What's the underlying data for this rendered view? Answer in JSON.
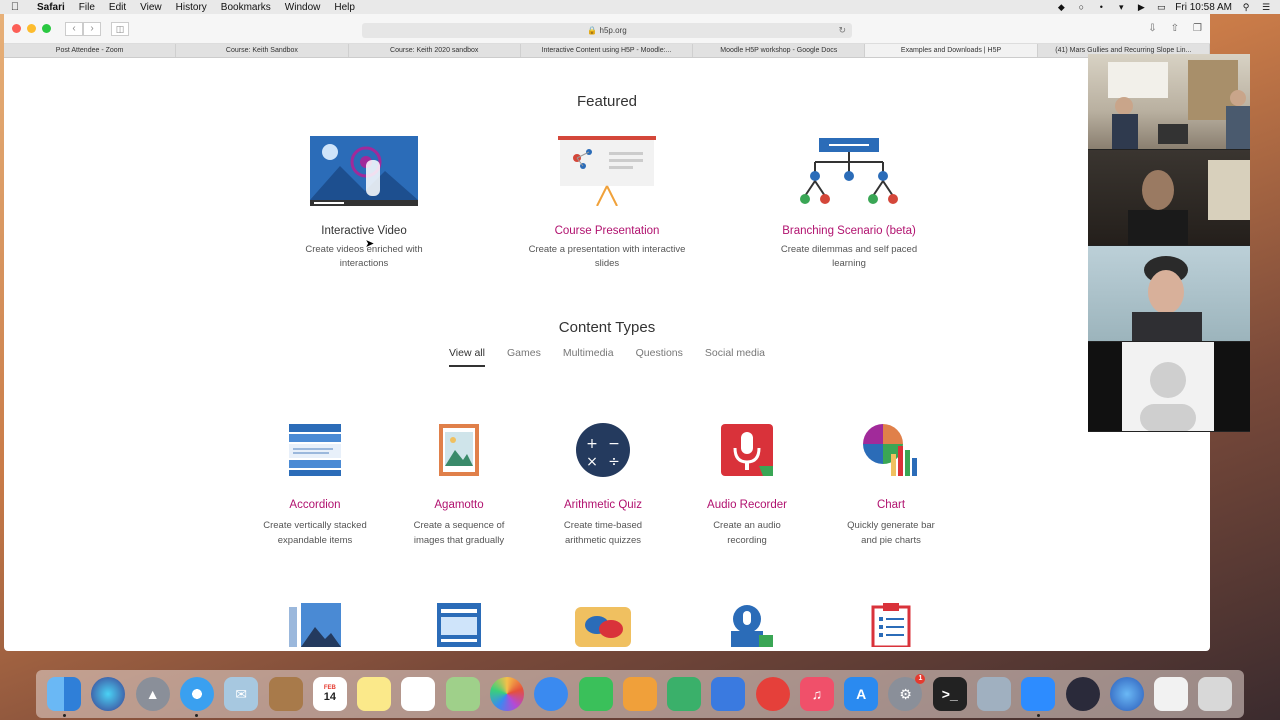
{
  "menubar": {
    "app": "Safari",
    "items": [
      "File",
      "Edit",
      "View",
      "History",
      "Bookmarks",
      "Window",
      "Help"
    ],
    "clock": "Fri 10:58 AM",
    "status_icons": [
      "dropbox-icon",
      "creative-cloud-icon",
      "bluetooth-icon",
      "wifi-icon",
      "volume-icon",
      "battery-icon",
      "search-icon",
      "notification-icon"
    ]
  },
  "browser": {
    "url": "h5p.org",
    "tabs": [
      "Post Attendee - Zoom",
      "Course: Keith Sandbox",
      "Course: Keith 2020 sandbox",
      "Interactive Content using H5P - Moodle:...",
      "Moodle H5P workshop - Google Docs",
      "Examples and Downloads | H5P",
      "(41) Mars Gullies and Recurring Slope Lin..."
    ],
    "active_tab": 5
  },
  "featured": {
    "title": "Featured",
    "items": [
      {
        "title": "Interactive Video",
        "desc_lines": [
          "Create videos enriched with",
          "interactions"
        ]
      },
      {
        "title": "Course Presentation",
        "desc_lines": [
          "Create a presentation with interactive",
          "slides"
        ]
      },
      {
        "title": "Branching Scenario (beta)",
        "desc_lines": [
          "Create dilemmas and self paced",
          "learning"
        ]
      }
    ]
  },
  "content_types": {
    "title": "Content Types",
    "filters": [
      "View all",
      "Games",
      "Multimedia",
      "Questions",
      "Social media"
    ],
    "active_filter": 0,
    "items": [
      {
        "title": "Accordion",
        "desc_lines": [
          "Create vertically stacked",
          "expandable items"
        ]
      },
      {
        "title": "Agamotto",
        "desc_lines": [
          "Create a sequence of",
          "images that gradually"
        ]
      },
      {
        "title": "Arithmetic Quiz",
        "desc_lines": [
          "Create time-based",
          "arithmetic quizzes"
        ]
      },
      {
        "title": "Audio Recorder",
        "desc_lines": [
          "Create an audio",
          "recording"
        ]
      },
      {
        "title": "Chart",
        "desc_lines": [
          "Quickly generate bar",
          "and pie charts"
        ]
      }
    ],
    "icon_arithmetic": "+ −\n× ÷"
  },
  "dock": {
    "calendar_day": "14",
    "calendar_month": "FEB",
    "badge": "1"
  },
  "colors": {
    "accent": "#b1126f",
    "text": "#333333"
  }
}
